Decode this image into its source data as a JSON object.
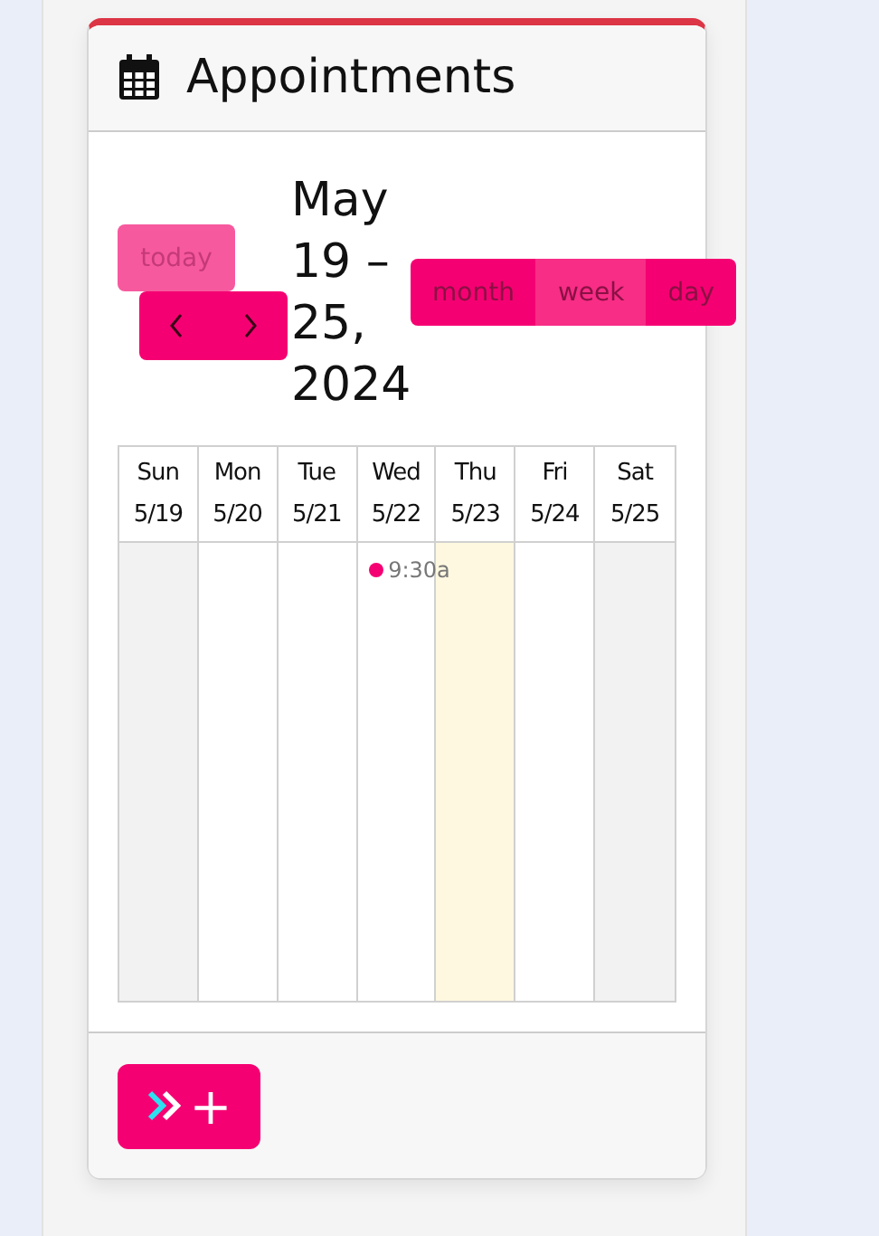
{
  "card": {
    "title": "Appointments"
  },
  "toolbar": {
    "today": {
      "label": "today",
      "disabled": true
    },
    "title": "May 19 – 25, 2024",
    "views": [
      {
        "label": "month",
        "selected": false
      },
      {
        "label": "week",
        "selected": true
      },
      {
        "label": "day",
        "selected": false
      }
    ]
  },
  "days": [
    {
      "name": "Sun",
      "date": "5/19",
      "kind": "weekend",
      "today": false
    },
    {
      "name": "Mon",
      "date": "5/20",
      "kind": "weekday",
      "today": false
    },
    {
      "name": "Tue",
      "date": "5/21",
      "kind": "weekday",
      "today": false
    },
    {
      "name": "Wed",
      "date": "5/22",
      "kind": "weekday",
      "today": false,
      "events": [
        {
          "time": "9:30a",
          "color": "#f50072"
        }
      ]
    },
    {
      "name": "Thu",
      "date": "5/23",
      "kind": "weekday",
      "today": true
    },
    {
      "name": "Fri",
      "date": "5/24",
      "kind": "weekday",
      "today": false
    },
    {
      "name": "Sat",
      "date": "5/25",
      "kind": "weekend",
      "today": false
    }
  ],
  "footer": {
    "add_label": "+"
  }
}
